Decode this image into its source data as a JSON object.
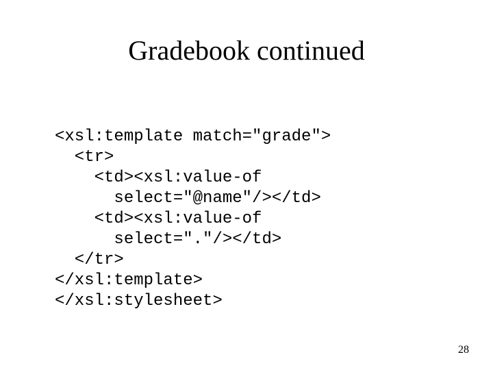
{
  "title": "Gradebook continued",
  "code": {
    "l1": "<xsl:template match=\"grade\">",
    "l2": "  <tr>",
    "l3": "    <td><xsl:value-of",
    "l4": "      select=\"@name\"/></td>",
    "l5": "    <td><xsl:value-of",
    "l6": "      select=\".\"/></td>",
    "l7": "  </tr>",
    "l8": "</xsl:template>",
    "l9": "</xsl:stylesheet>"
  },
  "page_number": "28"
}
